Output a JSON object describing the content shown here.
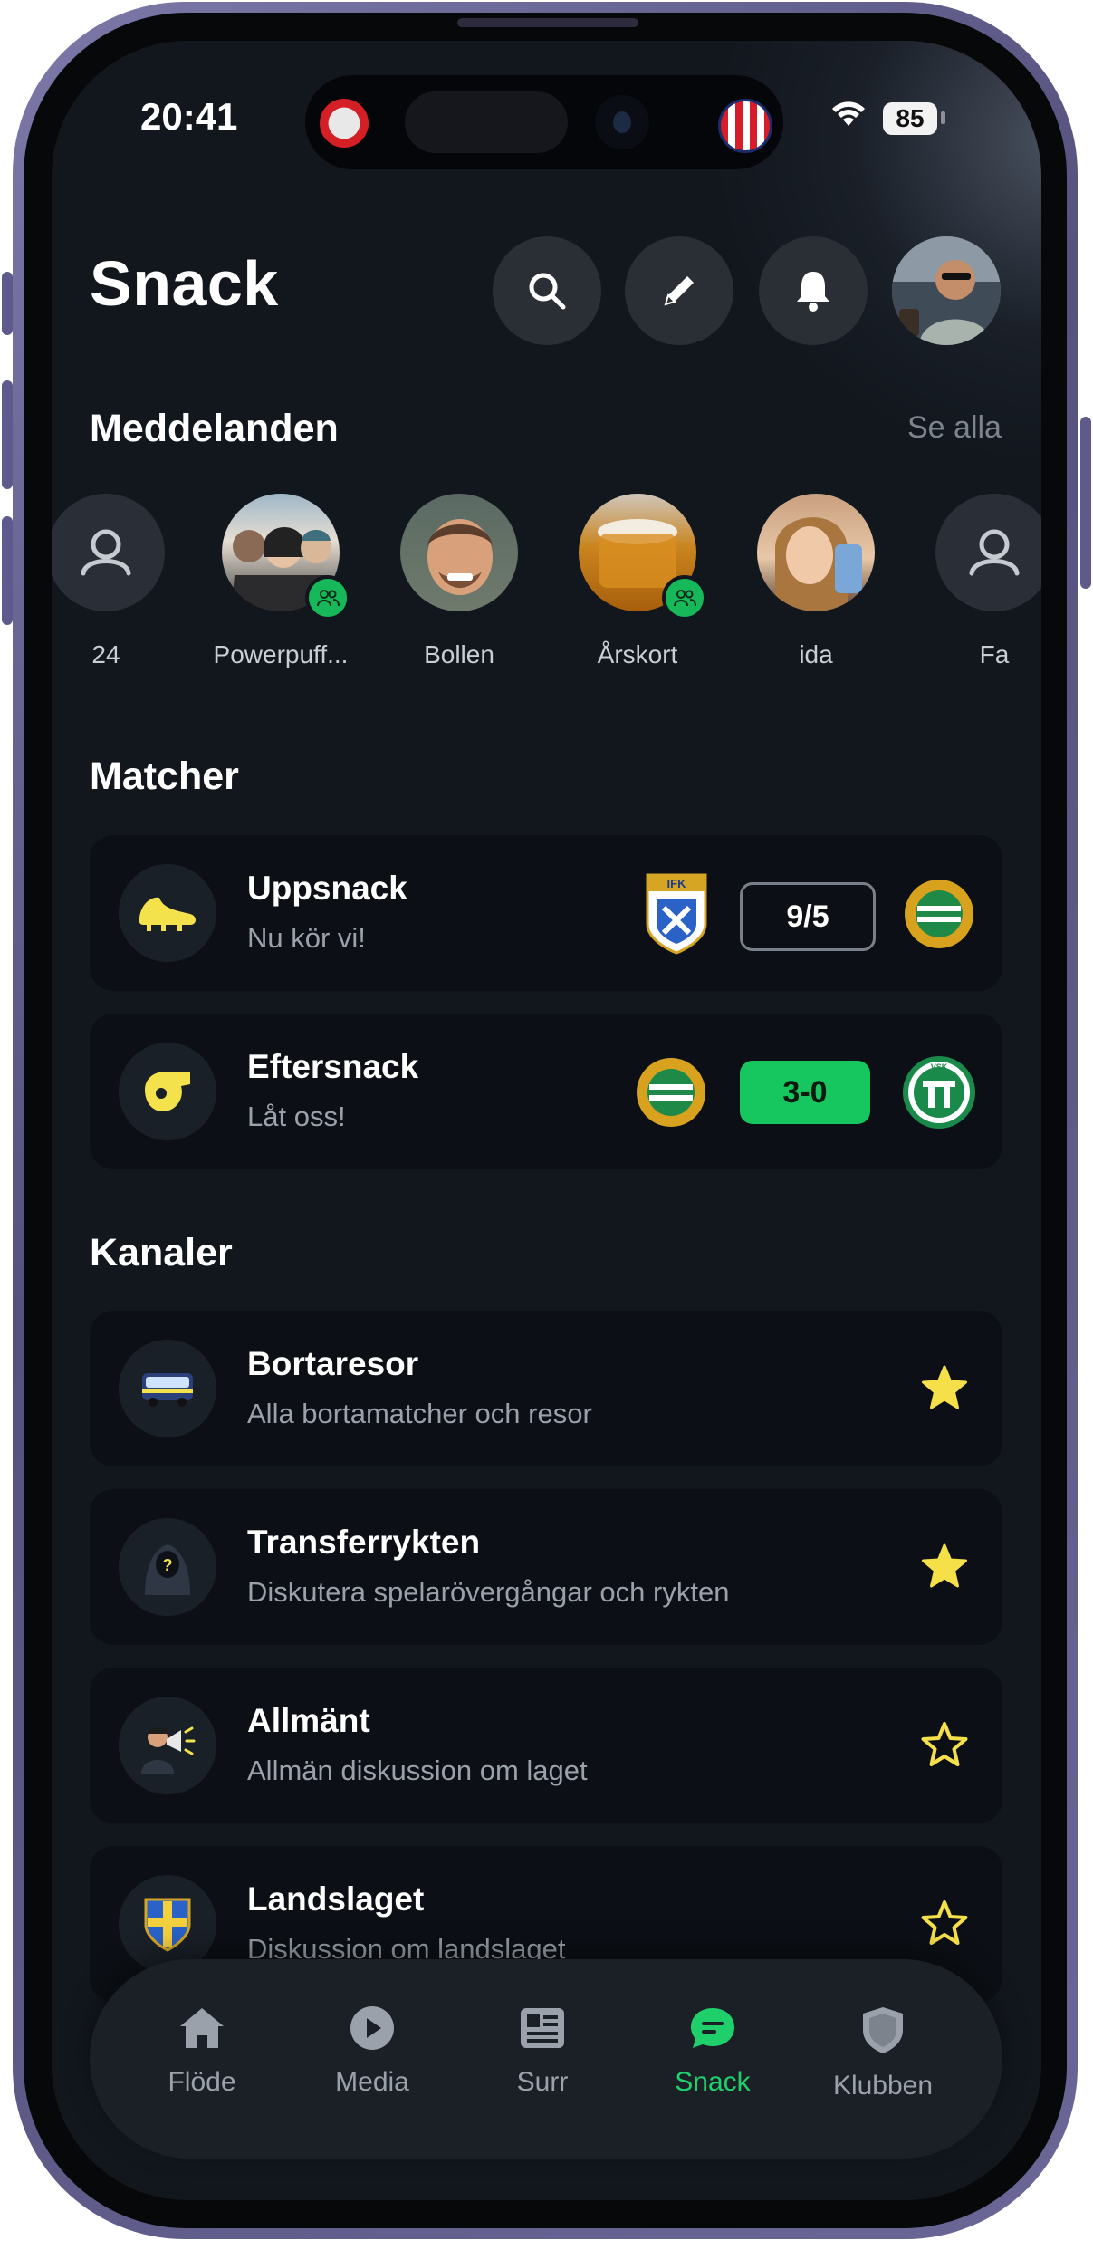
{
  "status": {
    "time": "20:41",
    "battery": "85"
  },
  "header": {
    "title": "Snack"
  },
  "messages": {
    "title": "Meddelanden",
    "see_all": "Se alla",
    "stories": [
      {
        "label": "24",
        "type": "placeholder"
      },
      {
        "label": "Powerpuff...",
        "type": "group"
      },
      {
        "label": "Bollen",
        "type": "person"
      },
      {
        "label": "Årskort",
        "type": "group"
      },
      {
        "label": "ida",
        "type": "person"
      },
      {
        "label": "Fa",
        "type": "placeholder"
      }
    ]
  },
  "matches": {
    "title": "Matcher",
    "items": [
      {
        "name": "Uppsnack",
        "subtitle": "Nu kör vi!",
        "score": "9/5",
        "icon": "football-boot-icon",
        "home_crest": "IFK",
        "away_crest": "hammarby-crest"
      },
      {
        "name": "Eftersnack",
        "subtitle": "Låt oss!",
        "score": "3-0",
        "icon": "whistle-icon",
        "home_crest": "hammarby-crest",
        "away_crest": "VSK"
      }
    ],
    "colors": {
      "score_win_bg": "#16c65e",
      "score_border": "#7a808a"
    }
  },
  "channels": {
    "title": "Kanaler",
    "items": [
      {
        "name": "Bortaresor",
        "subtitle": "Alla bortamatcher och resor",
        "icon": "bus-icon",
        "favorite": true
      },
      {
        "name": "Transferrykten",
        "subtitle": "Diskutera spelarövergångar och rykten",
        "icon": "hooded-figure-icon",
        "favorite": true
      },
      {
        "name": "Allmänt",
        "subtitle": "Allmän diskussion om laget",
        "icon": "megaphone-person-icon",
        "favorite": false
      },
      {
        "name": "Landslaget",
        "subtitle": "Diskussion om landslaget",
        "icon": "shield-cross-icon",
        "favorite": false
      }
    ]
  },
  "tabs": [
    {
      "label": "Flöde",
      "icon": "home-icon",
      "active": false
    },
    {
      "label": "Media",
      "icon": "play-icon",
      "active": false
    },
    {
      "label": "Surr",
      "icon": "newspaper-icon",
      "active": false
    },
    {
      "label": "Snack",
      "icon": "chat-icon",
      "active": true
    },
    {
      "label": "Klubben",
      "icon": "shield-icon",
      "active": false
    }
  ],
  "theme": {
    "accent": "#1fcf6b",
    "star": "#f5e04a",
    "background": "#12171e"
  }
}
